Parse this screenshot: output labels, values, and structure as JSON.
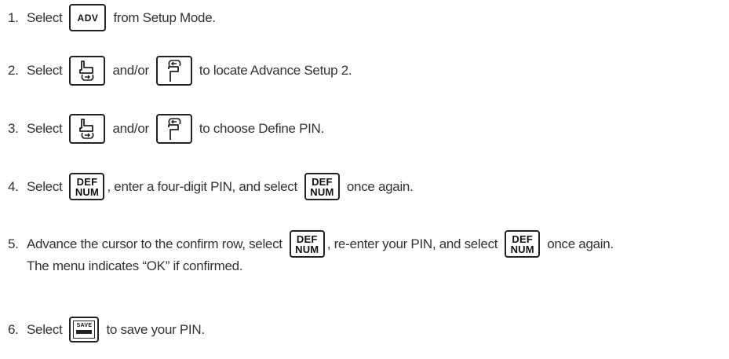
{
  "steps": [
    {
      "number": "1.",
      "parts": [
        "Select",
        "from Setup Mode."
      ]
    },
    {
      "number": "2.",
      "parts": [
        "Select",
        "and/or",
        "to locate Advance Setup 2."
      ]
    },
    {
      "number": "3.",
      "parts": [
        "Select",
        "and/or",
        "to choose Define PIN."
      ]
    },
    {
      "number": "4.",
      "parts": [
        "Select",
        ", enter a four-digit PIN, and select",
        "once again."
      ]
    },
    {
      "number": "5.",
      "parts": [
        "Advance the cursor to the confirm row, select",
        ", re-enter your PIN, and select",
        "once again."
      ],
      "continuation": "The menu indicates “OK” if confirmed."
    },
    {
      "number": "6.",
      "parts": [
        "Select",
        "to save your PIN."
      ]
    }
  ],
  "keys": {
    "adv": "ADV",
    "def_top": "DEF",
    "def_bottom": "NUM",
    "save": "SAVE"
  },
  "icons": {
    "down": "scroll-down-hand-icon",
    "up": "scroll-up-hand-icon"
  }
}
